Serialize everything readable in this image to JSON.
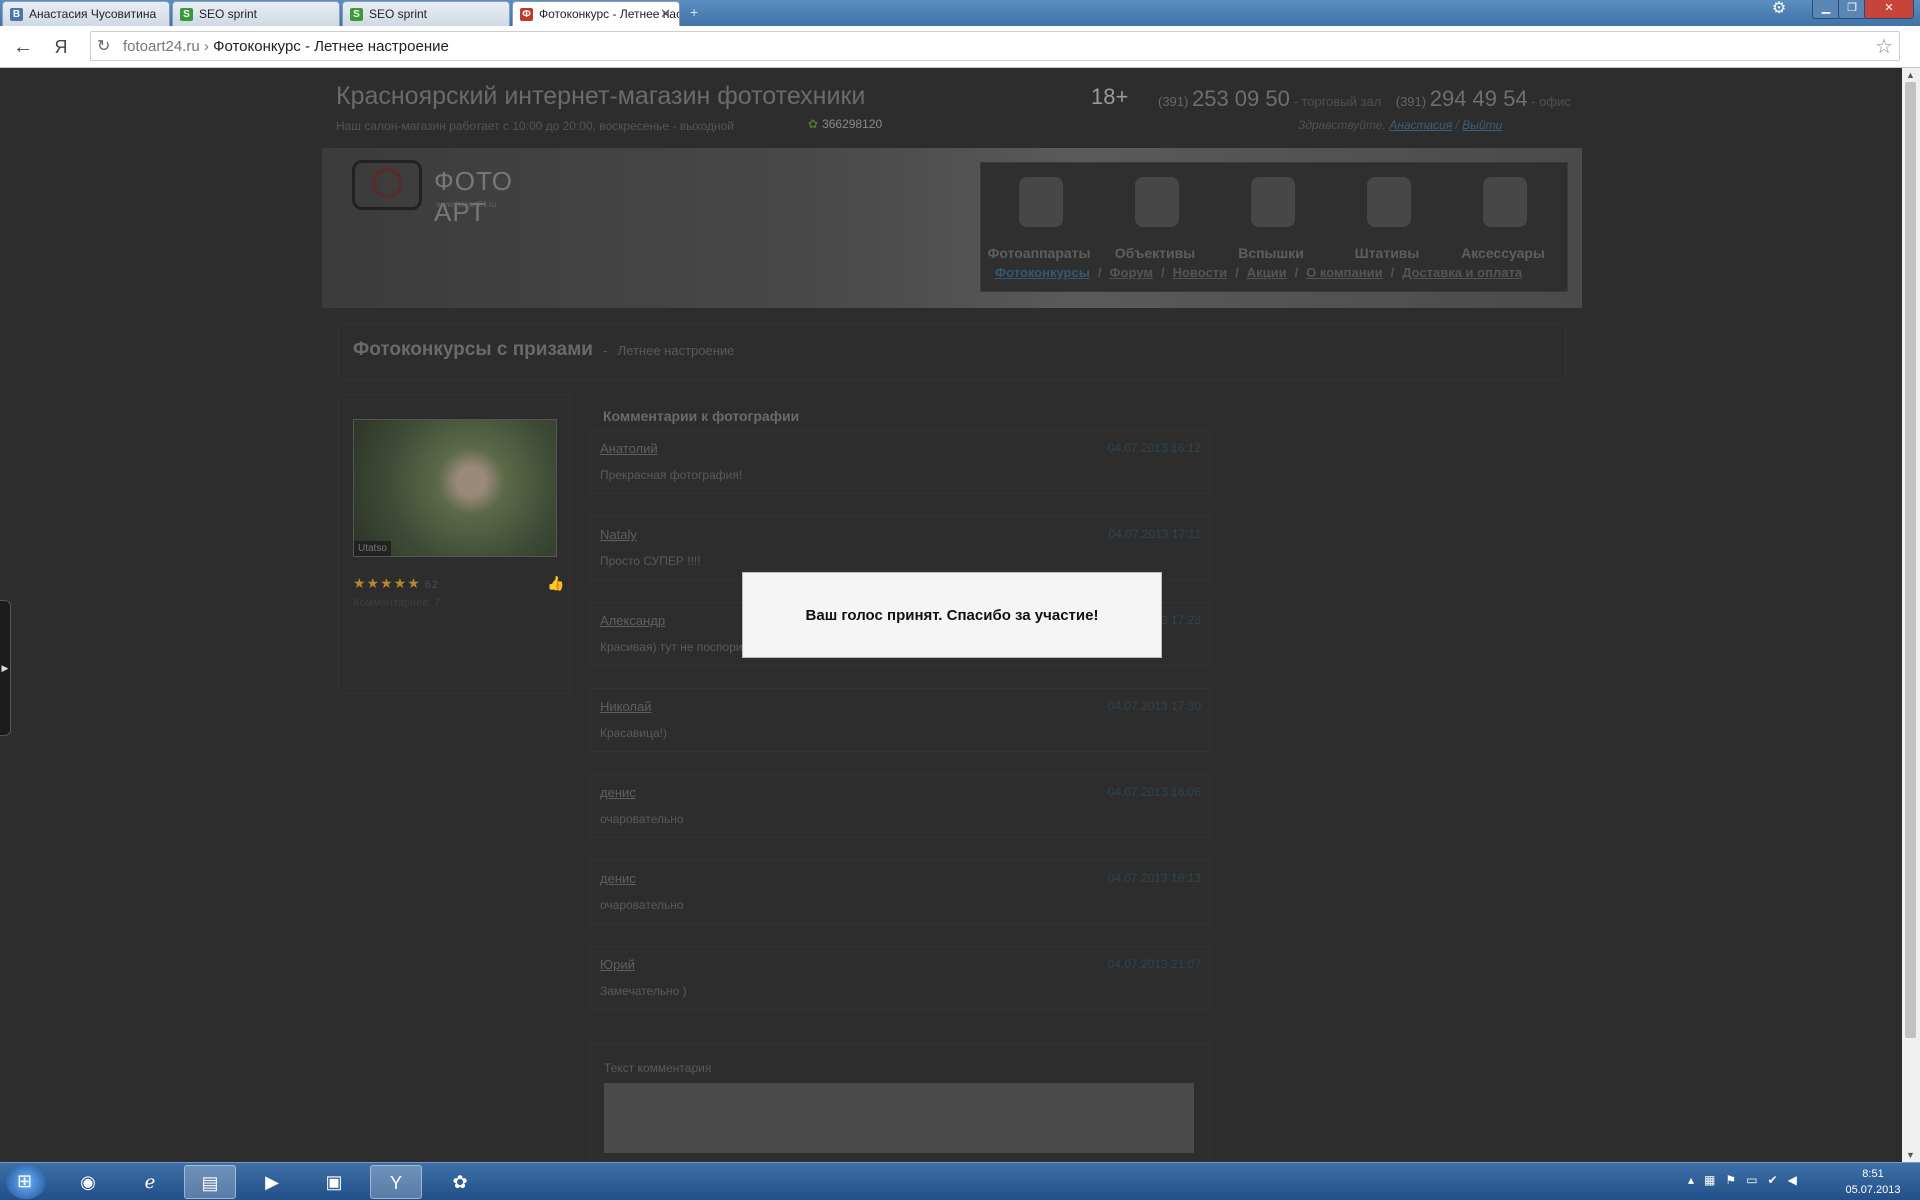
{
  "browser": {
    "tabs": [
      {
        "label": "Анастасия Чусовитина",
        "favicon": "В",
        "favicon_color": "#4a76a8"
      },
      {
        "label": "SEO sprint",
        "favicon": "S",
        "favicon_color": "#3a9a3a"
      },
      {
        "label": "SEO sprint",
        "favicon": "S",
        "favicon_color": "#3a9a3a"
      },
      {
        "label": "Фотоконкурс - Летнее настроение",
        "favicon": "Ф",
        "favicon_color": "#c0392b"
      }
    ],
    "yandex_button": "Я",
    "url_domain": "fotoart24.ru",
    "url_separator": "›",
    "url_title": "Фотоконкурс - Летнее настроение"
  },
  "header": {
    "site_title": "Красноярский интернет-магазин фототехники",
    "hours": "Наш салон-магазин работает с 10:00 до 20:00, воскресенье - выходной",
    "icq": "366298120",
    "age": "18+",
    "phone1_code": "(391)",
    "phone1": "253 09 50",
    "phone1_note": "- торговый зал",
    "phone2_code": "(391)",
    "phone2": "294 49 54",
    "phone2_note": "- офис",
    "greeting": "Здравствуйте,",
    "user": "Анастасия",
    "greet_sep": "/",
    "logout": "Выйти"
  },
  "logo": {
    "text": "ФОТО АРТ",
    "small": "www.fotoart24.ru"
  },
  "categories": [
    {
      "label": "Фотоаппараты"
    },
    {
      "label": "Объективы"
    },
    {
      "label": "Вспышки"
    },
    {
      "label": "Штативы"
    },
    {
      "label": "Аксессуары"
    }
  ],
  "menu": [
    {
      "label": "Фотоконкурсы"
    },
    {
      "label": "Форум"
    },
    {
      "label": "Новости"
    },
    {
      "label": "Акции"
    },
    {
      "label": "О компании"
    },
    {
      "label": "Доставка и оплата"
    }
  ],
  "menu_sep": "/",
  "breadcrumb": {
    "title": "Фотоконкурсы с призами",
    "dash": "-",
    "sub": "Летнее настроение"
  },
  "photo": {
    "author": "Utatso",
    "stars": "★★★★★",
    "rating": "62",
    "comments": "Комментариев: 7"
  },
  "comments_title": "Комментарии к фотографии",
  "comments": [
    {
      "author": "Анатолий",
      "date": "04.07.2013 16:12",
      "text": "Прекрасная фотография!"
    },
    {
      "author": "Nataly",
      "date": "04.07.2013 17:11",
      "text": "Просто СУПЕР !!!!"
    },
    {
      "author": "Александр",
      "date": "04.07.2013 17:28",
      "text": "Красивая) тут не поспоришь)"
    },
    {
      "author": "Николай",
      "date": "04.07.2013 17:30",
      "text": "Красавица!)"
    },
    {
      "author": "денис",
      "date": "04.07.2013 18:06",
      "text": "очаровательно"
    },
    {
      "author": "денис",
      "date": "04.07.2013 18:13",
      "text": "очаровательно"
    },
    {
      "author": "Юрий",
      "date": "04.07.2013 21:07",
      "text": "Замечательно )"
    }
  ],
  "comment_form_label": "Текст комментария",
  "modal_message": "Ваш голос принят. Спасибо за участие!",
  "taskbar": {
    "time": "8:51",
    "date": "05.07.2013"
  }
}
